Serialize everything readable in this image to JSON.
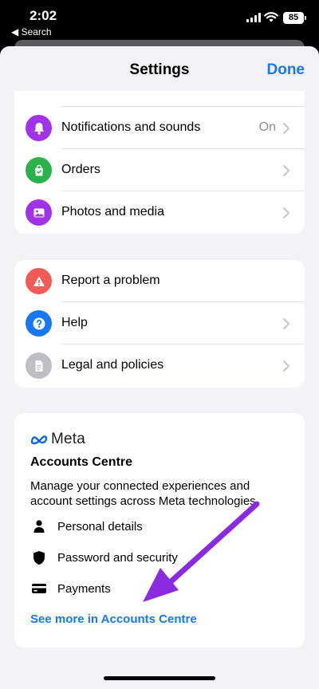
{
  "status": {
    "time": "2:02",
    "back_app": "◀ Search",
    "battery": "85"
  },
  "nav": {
    "title": "Settings",
    "done_label": "Done"
  },
  "group1": {
    "items": [
      {
        "label": "Notifications and sounds",
        "value": "On",
        "icon": "bell-icon",
        "color": "#a033e8"
      },
      {
        "label": "Orders",
        "value": "",
        "icon": "shopping-bag-icon",
        "color": "#2bb24c"
      },
      {
        "label": "Photos and media",
        "value": "",
        "icon": "photo-icon",
        "color": "#a033e8"
      }
    ]
  },
  "group2": {
    "items": [
      {
        "label": "Report a problem",
        "icon": "warning-icon",
        "color": "#f25c54"
      },
      {
        "label": "Help",
        "icon": "question-icon",
        "color": "#1877f2"
      },
      {
        "label": "Legal and policies",
        "icon": "document-icon",
        "color": "#bcc0c4"
      }
    ]
  },
  "meta": {
    "brand": "Meta",
    "title": "Accounts Centre",
    "description": "Manage your connected experiences and account settings across Meta technologies.",
    "items": [
      {
        "label": "Personal details",
        "icon": "person-icon"
      },
      {
        "label": "Password and security",
        "icon": "shield-icon"
      },
      {
        "label": "Payments",
        "icon": "card-icon"
      }
    ],
    "see_more": "See more in Accounts Centre"
  },
  "colors": {
    "accent": "#1877f2",
    "annotation_arrow": "#8a2be2"
  }
}
